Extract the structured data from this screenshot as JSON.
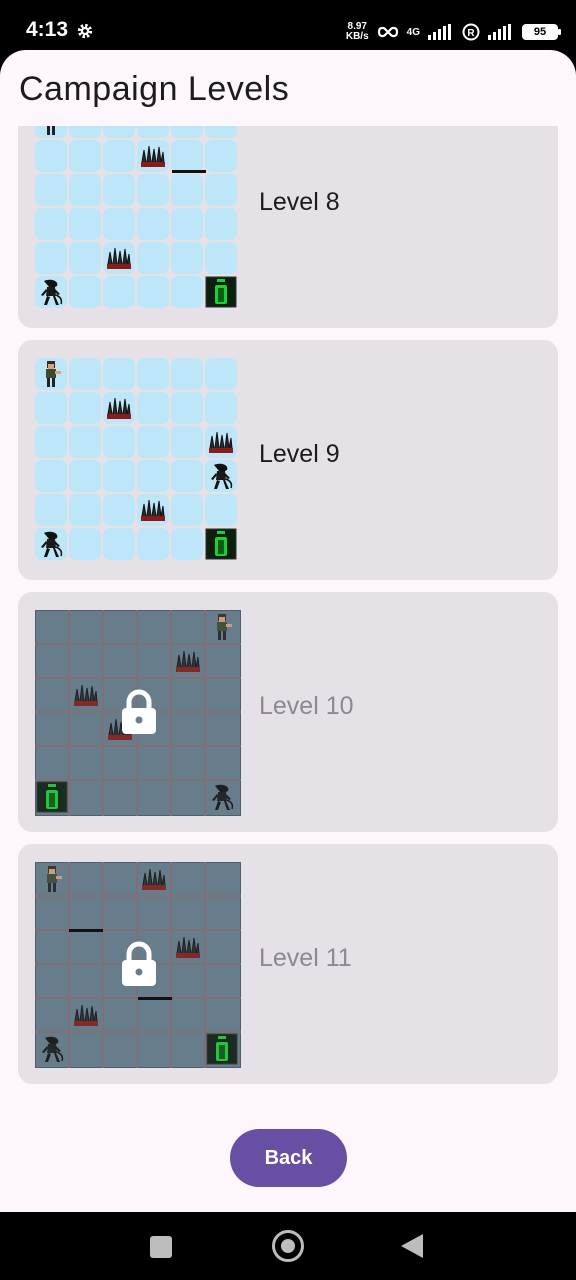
{
  "status_bar": {
    "time": "4:13",
    "network_speed_value": "8.97",
    "network_speed_unit": "KB/s",
    "network_type": "4G",
    "battery": "95"
  },
  "screen": {
    "title": "Campaign Levels"
  },
  "levels": [
    {
      "label": "Level 8",
      "locked": false
    },
    {
      "label": "Level 9",
      "locked": false
    },
    {
      "label": "Level 10",
      "locked": true
    },
    {
      "label": "Level 11",
      "locked": true
    }
  ],
  "back_button": {
    "label": "Back"
  },
  "icons": {
    "settings": "gear-icon",
    "lock": "lock-icon",
    "player": "soldier-sprite",
    "enemy": "alien-sprite",
    "trap": "spike-trap-sprite",
    "exit": "exit-door-sprite",
    "nav_recents": "square-icon",
    "nav_home": "circle-icon",
    "nav_back": "triangle-back-icon"
  },
  "colors": {
    "accent": "#6750a4",
    "card": "#e6e1e6",
    "tile": "#bde6f9",
    "locked_board": "#687d8c",
    "background": "#fdf7fd"
  }
}
